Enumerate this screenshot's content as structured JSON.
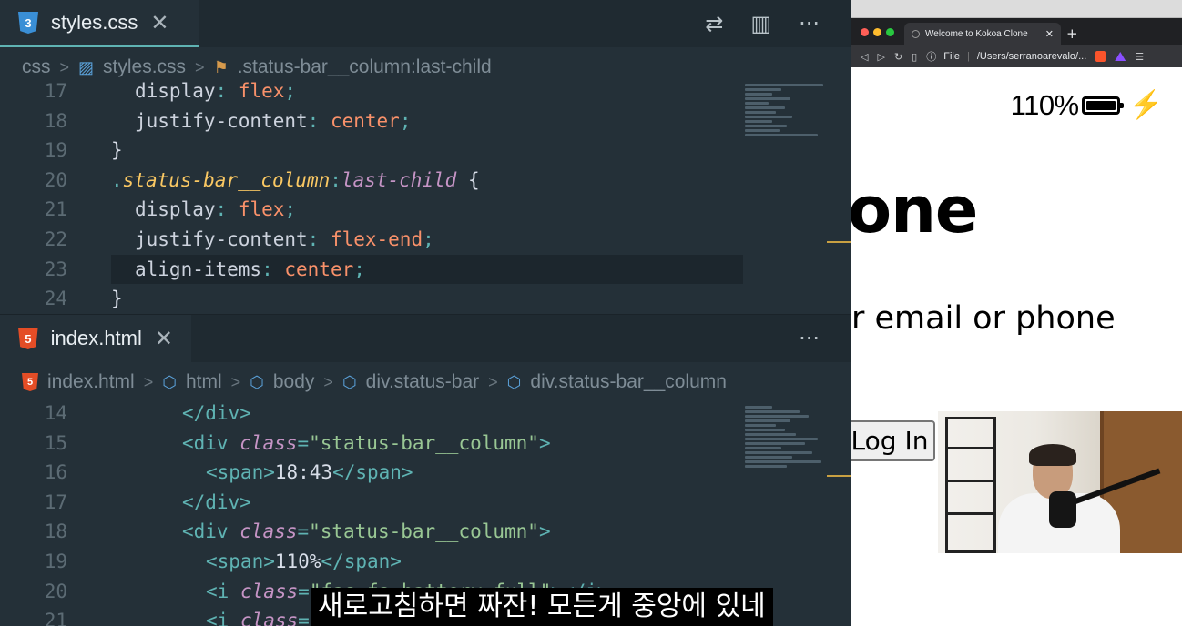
{
  "css_editor": {
    "tab": {
      "label": "styles.css",
      "close": "✕"
    },
    "actions": {
      "compare_icon": "⇄",
      "split_icon": "▥",
      "more": "···"
    },
    "breadcrumb": {
      "folder": "css",
      "file": "styles.css",
      "symbol": ".status-bar__column:last-child"
    },
    "lines": [
      {
        "num": "17",
        "tokens": [
          {
            "t": "display",
            "c": "prop"
          },
          {
            "t": ": ",
            "c": "punc"
          },
          {
            "t": "flex",
            "c": "val"
          },
          {
            "t": ";",
            "c": "punc"
          }
        ],
        "indent": 1
      },
      {
        "num": "18",
        "tokens": [
          {
            "t": "justify-content",
            "c": "prop"
          },
          {
            "t": ": ",
            "c": "punc"
          },
          {
            "t": "center",
            "c": "val"
          },
          {
            "t": ";",
            "c": "punc"
          }
        ],
        "indent": 1
      },
      {
        "num": "19",
        "tokens": [
          {
            "t": "}",
            "c": "brace"
          }
        ],
        "indent": 0
      },
      {
        "num": "20",
        "tokens": [
          {
            "t": ".",
            "c": "punc"
          },
          {
            "t": "status-bar__column",
            "c": "sel"
          },
          {
            "t": ":",
            "c": "punc"
          },
          {
            "t": "last-child",
            "c": "pseudo"
          },
          {
            "t": " {",
            "c": "brace"
          }
        ],
        "indent": 0
      },
      {
        "num": "21",
        "tokens": [
          {
            "t": "display",
            "c": "prop"
          },
          {
            "t": ": ",
            "c": "punc"
          },
          {
            "t": "flex",
            "c": "val"
          },
          {
            "t": ";",
            "c": "punc"
          }
        ],
        "indent": 1
      },
      {
        "num": "22",
        "tokens": [
          {
            "t": "justify-content",
            "c": "prop"
          },
          {
            "t": ": ",
            "c": "punc"
          },
          {
            "t": "flex-end",
            "c": "val"
          },
          {
            "t": ";",
            "c": "punc"
          }
        ],
        "indent": 1
      },
      {
        "num": "23",
        "tokens": [
          {
            "t": "align-items",
            "c": "prop"
          },
          {
            "t": ": ",
            "c": "punc"
          },
          {
            "t": "center",
            "c": "val"
          },
          {
            "t": ";",
            "c": "punc"
          }
        ],
        "indent": 1,
        "active": true
      },
      {
        "num": "24",
        "tokens": [
          {
            "t": "}",
            "c": "brace"
          }
        ],
        "indent": 0
      }
    ]
  },
  "html_editor": {
    "tab": {
      "label": "index.html",
      "close": "✕"
    },
    "actions": {
      "more": "···"
    },
    "breadcrumb": [
      "index.html",
      "html",
      "body",
      "div.status-bar",
      "div.status-bar__column"
    ],
    "lines": [
      {
        "num": "14",
        "tokens": [
          {
            "t": "</",
            "c": "tag"
          },
          {
            "t": "div",
            "c": "tag"
          },
          {
            "t": ">",
            "c": "tag"
          }
        ],
        "indent": 3
      },
      {
        "num": "15",
        "tokens": [
          {
            "t": "<div ",
            "c": "tag"
          },
          {
            "t": "class",
            "c": "attr"
          },
          {
            "t": "=",
            "c": "punc"
          },
          {
            "t": "\"status-bar__column\"",
            "c": "str"
          },
          {
            "t": ">",
            "c": "tag"
          }
        ],
        "indent": 3
      },
      {
        "num": "16",
        "tokens": [
          {
            "t": "<span>",
            "c": "tag"
          },
          {
            "t": "18:43",
            "c": "text"
          },
          {
            "t": "</span>",
            "c": "tag"
          }
        ],
        "indent": 4
      },
      {
        "num": "17",
        "tokens": [
          {
            "t": "</div>",
            "c": "tag"
          }
        ],
        "indent": 3
      },
      {
        "num": "18",
        "tokens": [
          {
            "t": "<div ",
            "c": "tag"
          },
          {
            "t": "class",
            "c": "attr"
          },
          {
            "t": "=",
            "c": "punc"
          },
          {
            "t": "\"status-bar__column\"",
            "c": "str"
          },
          {
            "t": ">",
            "c": "tag"
          }
        ],
        "indent": 3
      },
      {
        "num": "19",
        "tokens": [
          {
            "t": "<span>",
            "c": "tag"
          },
          {
            "t": "110%",
            "c": "text"
          },
          {
            "t": "</span>",
            "c": "tag"
          }
        ],
        "indent": 4
      },
      {
        "num": "20",
        "tokens": [
          {
            "t": "<i ",
            "c": "tag"
          },
          {
            "t": "class",
            "c": "attr"
          },
          {
            "t": "=",
            "c": "punc"
          },
          {
            "t": "\"fas fa-battery-full\"",
            "c": "str"
          },
          {
            "t": "></i>",
            "c": "tag"
          }
        ],
        "indent": 4
      },
      {
        "num": "21",
        "tokens": [
          {
            "t": "<i ",
            "c": "tag"
          },
          {
            "t": "class",
            "c": "attr"
          },
          {
            "t": "=",
            "c": "punc"
          },
          {
            "t": "\"fas fa-bolt\"",
            "c": "str"
          },
          {
            "t": "></i>",
            "c": "tag"
          }
        ],
        "indent": 4
      }
    ]
  },
  "browser": {
    "tab_title": "Welcome to Kokoa Clone",
    "tab_close": "✕",
    "new_tab": "+",
    "address_scheme": "File",
    "address_path": "/Users/serranoarevalo/...",
    "page": {
      "battery_percent": "110%",
      "bolt": "⚡",
      "heading_visible": "one",
      "hint_visible": "r email or phone",
      "login_button": "Log In"
    }
  },
  "subtitle": "새로고침하면 짜잔! 모든게 중앙에 있네",
  "colors": {
    "editor_bg": "#243038",
    "tab_accent": "#5fb3b3",
    "css_icon": "#3a8fd6",
    "html_icon": "#e44d26"
  }
}
